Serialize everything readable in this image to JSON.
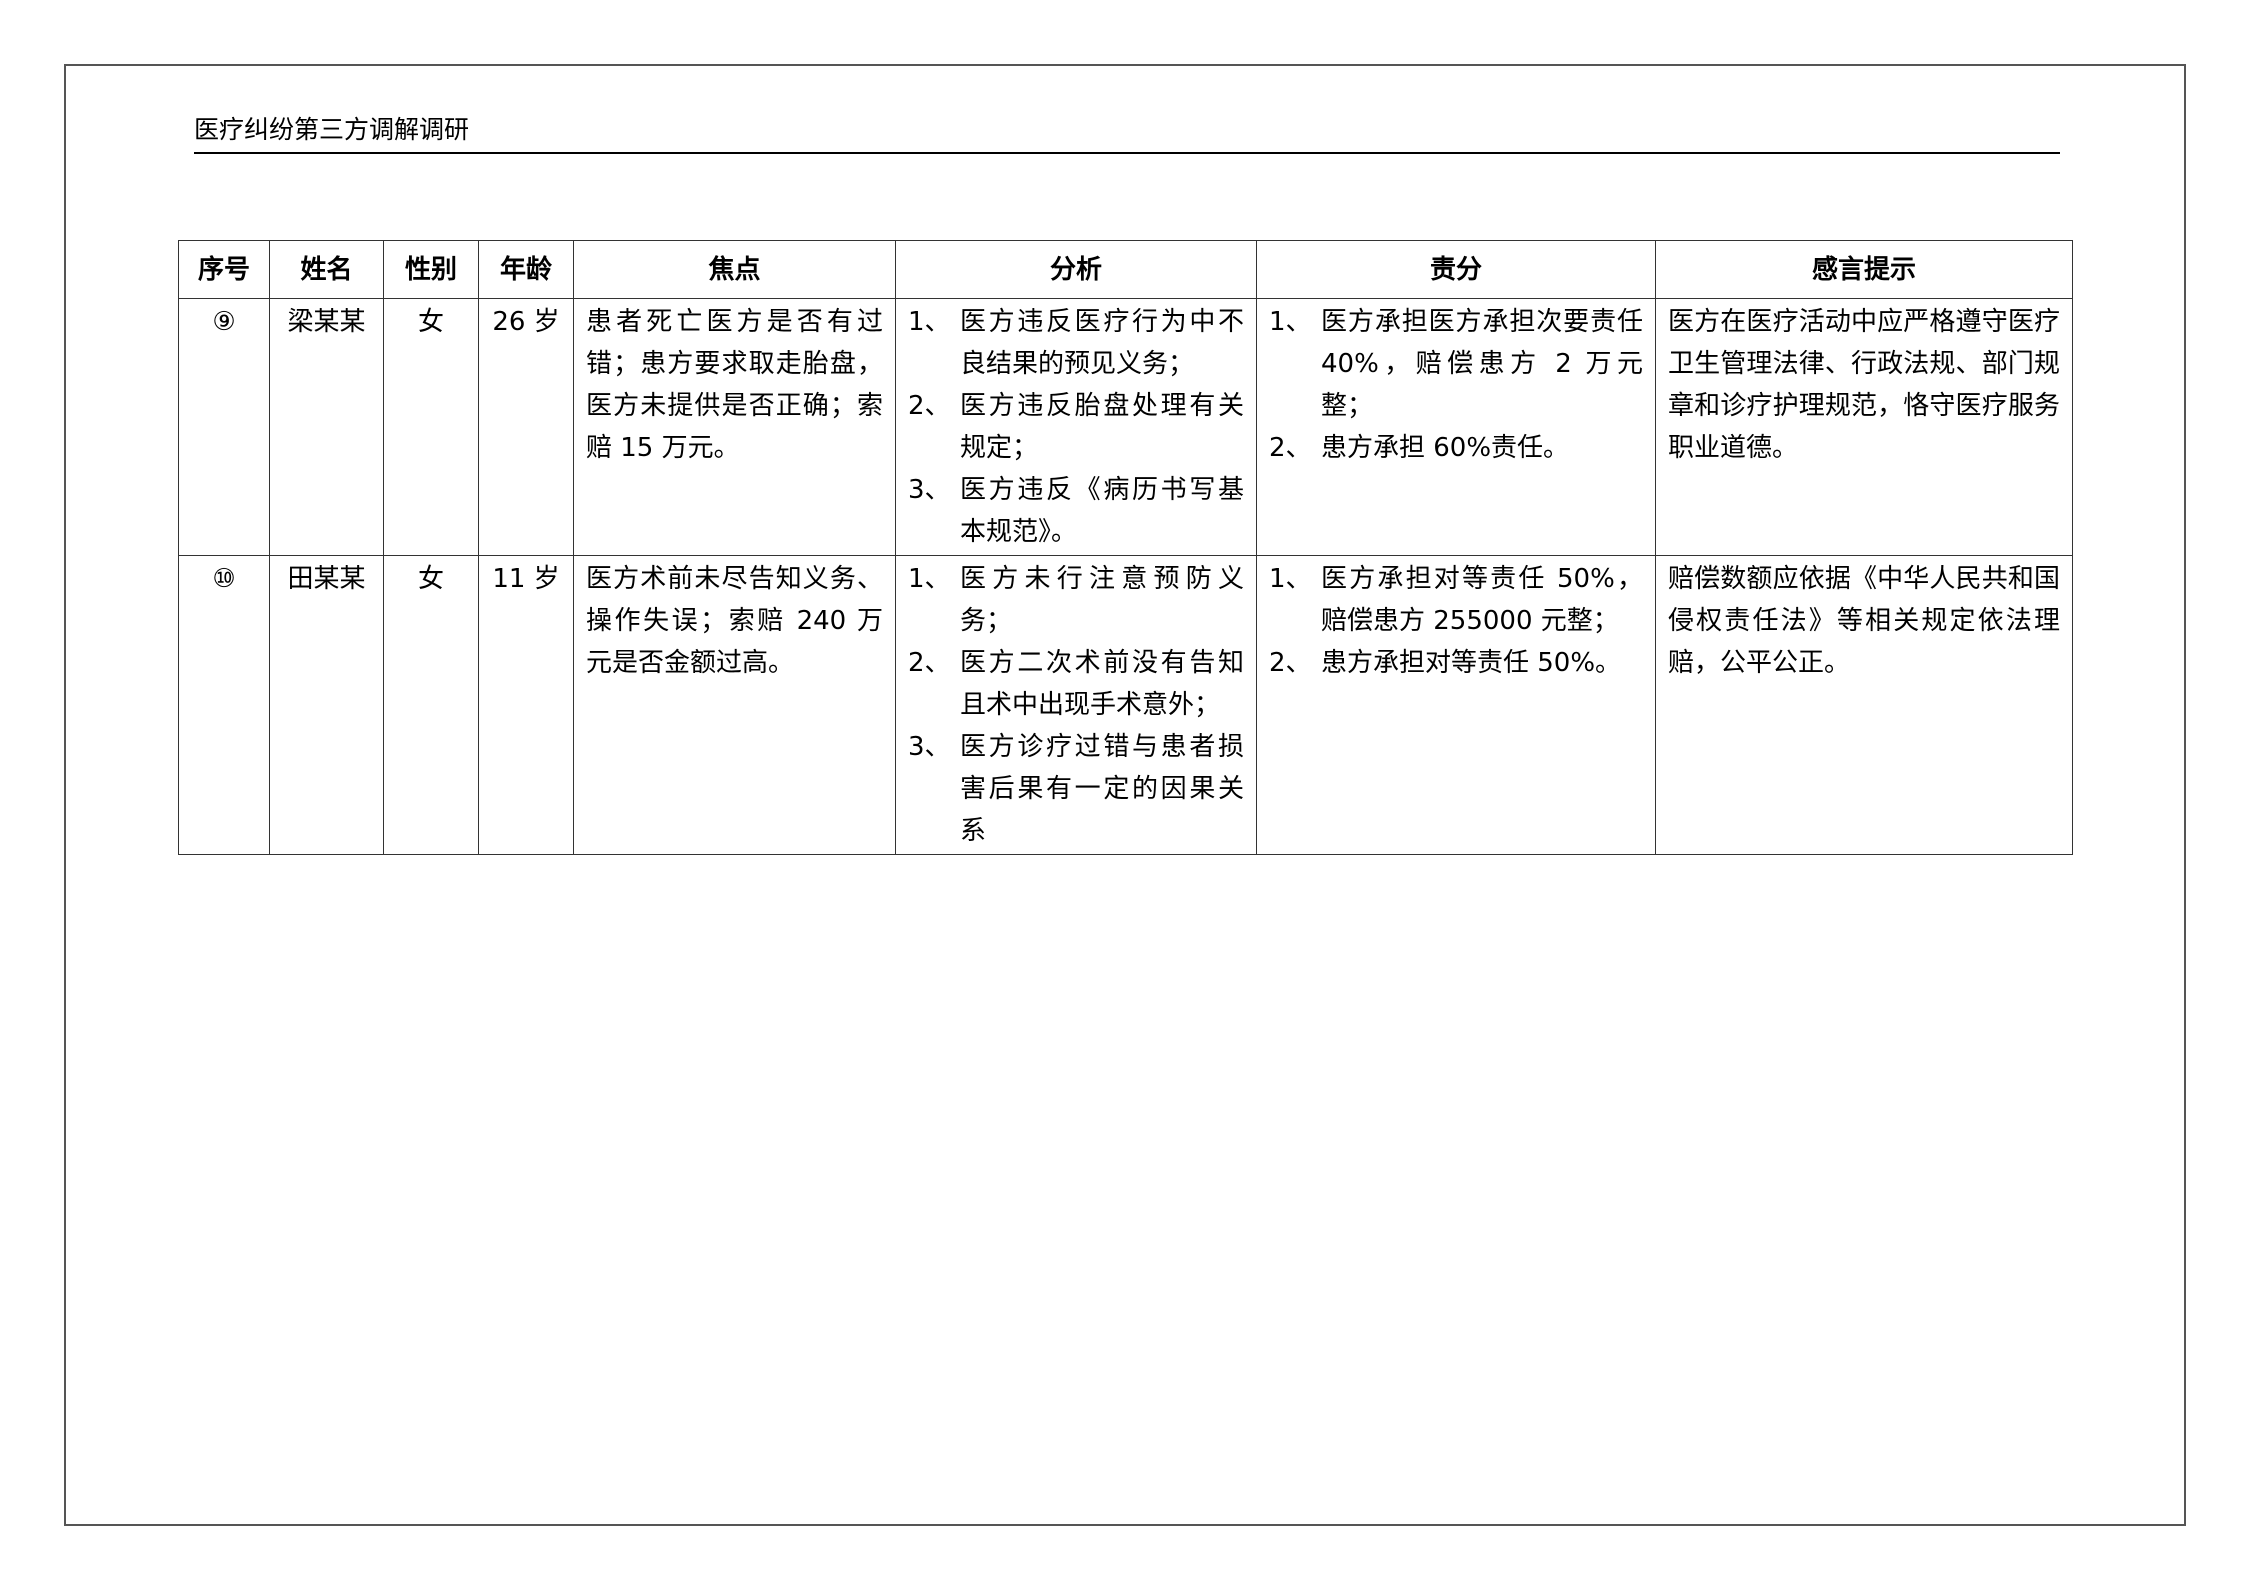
{
  "document": {
    "header_title": "医疗纠纷第三方调解调研"
  },
  "table": {
    "columns": [
      "序号",
      "姓名",
      "性别",
      "年龄",
      "焦点",
      "分析",
      "责分",
      "感言提示"
    ],
    "rows": [
      {
        "index": "⑨",
        "name": "梁某某",
        "gender": "女",
        "age": "26 岁",
        "focus": "患者死亡医方是否有过错；患方要求取走胎盘，医方未提供是否正确；索赔 15 万元。",
        "analysis": [
          {
            "num": "1、",
            "text": "医方违反医疗行为中不良结果的预见义务；"
          },
          {
            "num": "2、",
            "text": "医方违反胎盘处理有关规定；"
          },
          {
            "num": "3、",
            "text": "医方违反《病历书写基本规范》。"
          }
        ],
        "liability": [
          {
            "num": "1、",
            "text": "医方承担医方承担次要责任 40%，赔偿患方 2 万元整；"
          },
          {
            "num": "2、",
            "text": "患方承担 60%责任。"
          }
        ],
        "remark": "医方在医疗活动中应严格遵守医疗卫生管理法律、行政法规、部门规章和诊疗护理规范，恪守医疗服务职业道德。"
      },
      {
        "index": "⑩",
        "name": "田某某",
        "gender": "女",
        "age": "11 岁",
        "focus": "医方术前未尽告知义务、操作失误；索赔 240 万元是否金额过高。",
        "analysis": [
          {
            "num": "1、",
            "text": "医方未行注意预防义务；"
          },
          {
            "num": "2、",
            "text": "医方二次术前没有告知且术中出现手术意外；"
          },
          {
            "num": "3、",
            "text": "医方诊疗过错与患者损害后果有一定的因果关系"
          }
        ],
        "liability": [
          {
            "num": "1、",
            "text": "医方承担对等责任 50%，赔偿患方 255000 元整；"
          },
          {
            "num": "2、",
            "text": "患方承担对等责任 50%。"
          }
        ],
        "remark": "赔偿数额应依据《中华人民共和国侵权责任法》等相关规定依法理赔，公平公正。"
      }
    ]
  }
}
